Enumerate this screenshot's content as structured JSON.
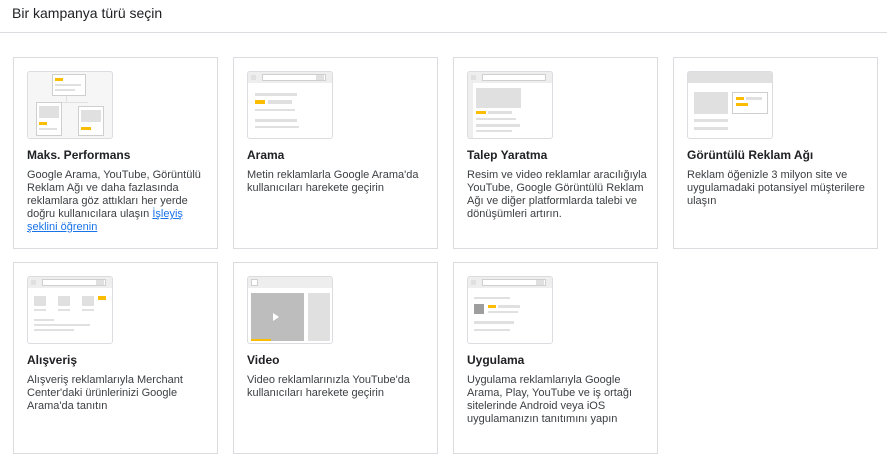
{
  "header": {
    "title": "Bir kampanya türü seçin"
  },
  "cards": [
    {
      "title": "Maks. Performans",
      "desc": "Google Arama, YouTube, Görüntülü Reklam Ağı ve daha fazlasında reklamlara göz attıkları her yerde doğru kullanıcılara ulaşın ",
      "link": "İşleyiş şeklini öğrenin"
    },
    {
      "title": "Arama",
      "desc": "Metin reklamlarla Google Arama'da kullanıcıları harekete geçirin"
    },
    {
      "title": "Talep Yaratma",
      "desc": "Resim ve video reklamlar aracılığıyla YouTube, Google Görüntülü Reklam Ağı ve diğer platformlarda talebi ve dönüşümleri artırın."
    },
    {
      "title": "Görüntülü Reklam Ağı",
      "desc": "Reklam öğenizle 3 milyon site ve uygulamadaki potansiyel müşterilere ulaşın"
    },
    {
      "title": "Alışveriş",
      "desc": "Alışveriş reklamlarıyla Merchant Center'daki ürünlerinizi Google Arama'da tanıtın"
    },
    {
      "title": "Video",
      "desc": "Video reklamlarınızla YouTube'da kullanıcıları harekete geçirin"
    },
    {
      "title": "Uygulama",
      "desc": "Uygulama reklamlarıyla Google Arama, Play, YouTube ve iş ortağı sitelerinde Android veya iOS uygulamanızın tanıtımını yapın"
    }
  ],
  "icons": {
    "maks": "performance-max-illustration-icon",
    "arama": "search-illustration-icon",
    "talep": "demand-gen-illustration-icon",
    "display": "display-illustration-icon",
    "shopping": "shopping-illustration-icon",
    "video": "video-illustration-icon",
    "app": "app-illustration-icon"
  },
  "colors": {
    "accent": "#fbbc04",
    "link": "#1a73e8",
    "border": "#dadce0",
    "placeholder": "#e0e0e0"
  }
}
